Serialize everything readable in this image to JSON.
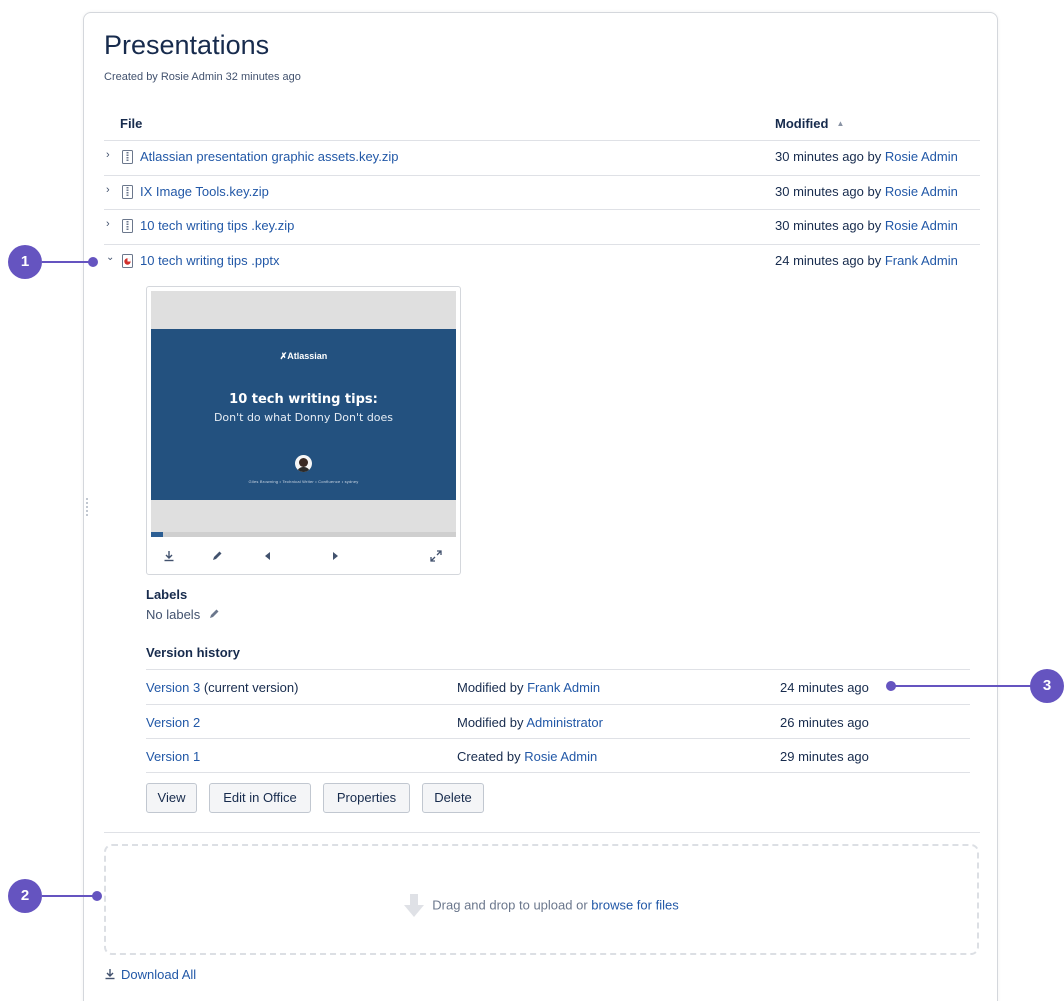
{
  "page": {
    "title": "Presentations",
    "byline": "Created by Rosie Admin 32 minutes ago"
  },
  "table": {
    "col_file": "File",
    "col_modified": "Modified",
    "rows": [
      {
        "name": "Atlassian presentation graphic assets.key.zip",
        "modified_prefix": "30 minutes ago by ",
        "modified_by": "Rosie Admin",
        "expanded": false,
        "icon": "zip-file-icon"
      },
      {
        "name": "IX Image Tools.key.zip",
        "modified_prefix": "30 minutes ago by ",
        "modified_by": "Rosie Admin",
        "expanded": false,
        "icon": "zip-file-icon"
      },
      {
        "name": "10 tech writing tips .key.zip",
        "modified_prefix": "30 minutes ago by ",
        "modified_by": "Rosie Admin",
        "expanded": false,
        "icon": "zip-file-icon"
      },
      {
        "name": "10 tech writing tips .pptx",
        "modified_prefix": "24 minutes ago by ",
        "modified_by": "Frank Admin",
        "expanded": true,
        "icon": "powerpoint-file-icon"
      }
    ]
  },
  "preview": {
    "brand": "✗Atlassian",
    "slide_title": "10 tech writing tips:",
    "slide_subtitle": "Don't do what Donny Don't does",
    "slide_footer": "Giles Browning  •  Technical Writer  •  Confluence  •  sydney",
    "progress": 0.04
  },
  "labels": {
    "heading": "Labels",
    "value": "No labels"
  },
  "versions": {
    "heading": "Version history",
    "rows": [
      {
        "name": "Version 3",
        "suffix": " (current version)",
        "action": "Modified by ",
        "user": "Frank Admin",
        "when": "24 minutes ago"
      },
      {
        "name": "Version 2",
        "suffix": "",
        "action": "Modified by ",
        "user": "Administrator",
        "when": "26 minutes ago"
      },
      {
        "name": "Version 1",
        "suffix": "",
        "action": "Created by ",
        "user": "Rosie Admin",
        "when": "29 minutes ago"
      }
    ]
  },
  "buttons": {
    "view": "View",
    "edit_office": "Edit in Office",
    "properties": "Properties",
    "delete": "Delete"
  },
  "dropzone": {
    "text": "Drag and drop to upload or ",
    "link": "browse for files"
  },
  "download_all": "Download All",
  "callouts": [
    "1",
    "2",
    "3"
  ],
  "colors": {
    "link": "#2258a7",
    "callout": "#6554c0",
    "slide_bg": "#23517f"
  }
}
